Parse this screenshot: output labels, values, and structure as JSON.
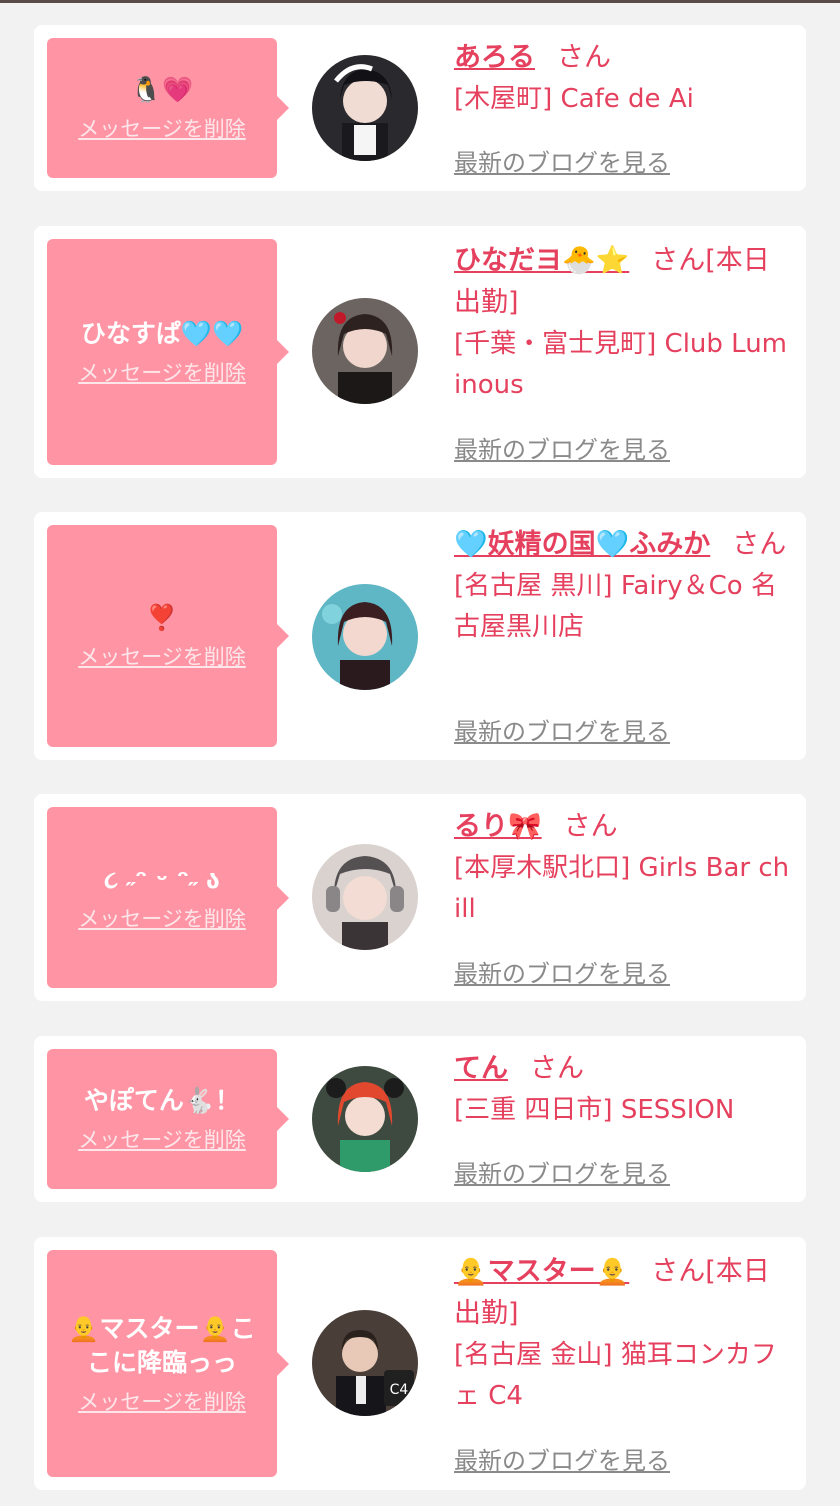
{
  "delete_label": "メッセージを削除",
  "san_label": "さん",
  "blog_label": "最新のブログを見る",
  "colors": {
    "accent": "#e5405e",
    "bubble": "#ff95a4",
    "background": "#f2f2f2"
  },
  "entries": [
    {
      "message": "🐧💗",
      "name": "あろる",
      "suffix": "",
      "shop": "[木屋町] Cafe de Ai",
      "avatar_icon": "maid-portrait-icon"
    },
    {
      "message": "ひなすぱ🩵🩵",
      "name": "ひなだヨ🐣⭐️",
      "suffix": "[本日出勤]",
      "shop": "[千葉・富士見町] Club Luminous",
      "avatar_icon": "girl-portrait-icon"
    },
    {
      "message": "❣️",
      "name": "🩵妖精の国🩵ふみか",
      "suffix": "",
      "shop": "[名古屋 黒川] Fairy＆Co 名古屋黒川店",
      "avatar_icon": "girl-portrait-icon"
    },
    {
      "message": "૮ ˶ᵔ ᵕ ᵔ˶ ა",
      "name": "るり🎀",
      "suffix": "",
      "shop": "[本厚木駅北口] Girls Bar chill",
      "avatar_icon": "girl-portrait-icon"
    },
    {
      "message": "やぽてん🐇！",
      "name": "てん",
      "suffix": "",
      "shop": "[三重 四日市] SESSION",
      "avatar_icon": "redhair-portrait-icon"
    },
    {
      "message": "🧑‍🦲マスター🧑‍🦲ここに降臨っっ",
      "name": "🧑‍🦲マスター🧑‍🦲",
      "suffix": "[本日出勤]",
      "shop": "[名古屋 金山] 猫耳コンカフェ C4",
      "avatar_icon": "man-portrait-icon"
    }
  ]
}
